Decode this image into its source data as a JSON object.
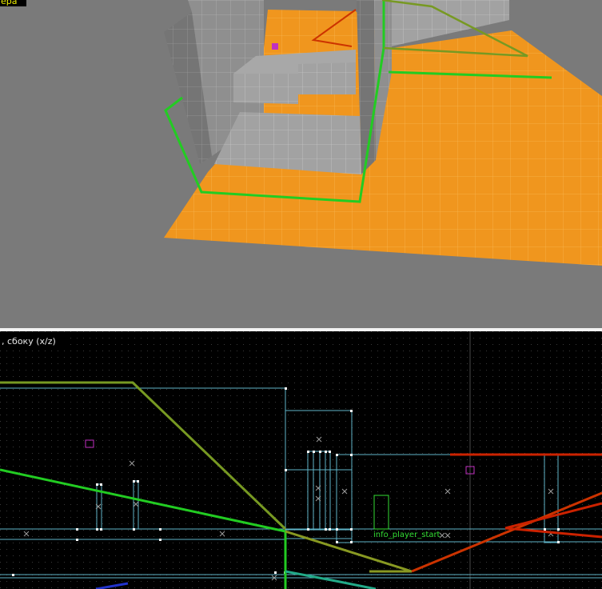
{
  "viewports": {
    "camera": {
      "label": "ера"
    },
    "side": {
      "label": ", сбоку (x/z)"
    }
  },
  "entities": {
    "player_start": "info_player_start"
  },
  "colors": {
    "orange_floor": "#f0961e",
    "wall_gray": "#8c8c8c",
    "path_green": "#22cc22",
    "path_olive": "#779922",
    "path_red": "#cc2200",
    "brush_cyan": "#5fb4c8",
    "marker_magenta": "#c030c0"
  },
  "icons": [
    "entity-marker-icon",
    "origin-x-icon"
  ]
}
